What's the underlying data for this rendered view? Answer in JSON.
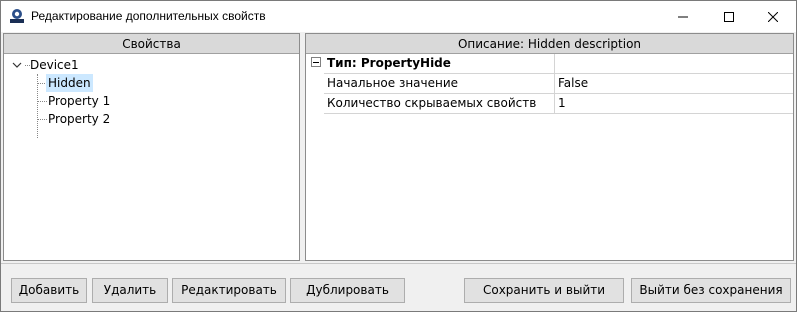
{
  "window": {
    "title": "Редактирование дополнительных свойств",
    "icon": "app-icon",
    "controls": {
      "minimize": "minimize-icon",
      "maximize": "maximize-icon",
      "close": "close-icon"
    }
  },
  "properties_panel": {
    "header": "Свойства",
    "tree": {
      "root": "Device1",
      "expanded": true,
      "children": [
        {
          "label": "Hidden",
          "selected": true
        },
        {
          "label": "Property 1",
          "selected": false
        },
        {
          "label": "Property 2",
          "selected": false
        }
      ]
    }
  },
  "description_panel": {
    "header": "Описание: Hidden description",
    "category": {
      "label": "Тип: PropertyHide",
      "value": ""
    },
    "rows": [
      {
        "name": "Начальное значение",
        "value": "False"
      },
      {
        "name": "Количество скрываемых свойств",
        "value": "1"
      }
    ]
  },
  "buttons": {
    "add": "Добавить",
    "delete": "Удалить",
    "edit": "Редактировать",
    "duplicate": "Дублировать",
    "save_exit": "Сохранить и выйти",
    "exit_no_save": "Выйти без сохранения"
  },
  "colors": {
    "selection": "#cce8ff",
    "header_bg": "#d9d9d9",
    "button_bg": "#e1e1e1",
    "window_bg": "#f0f0f0"
  }
}
